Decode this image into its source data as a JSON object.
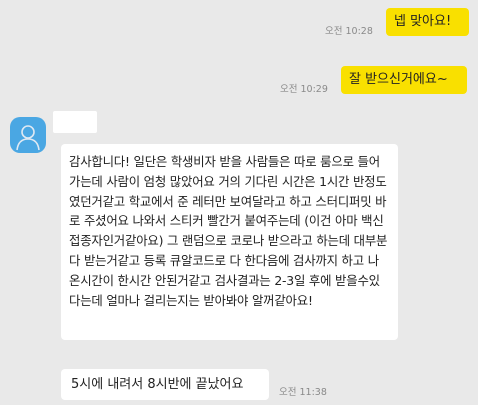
{
  "messages": [
    {
      "from": "me",
      "text": "넵 맞아요!",
      "time": "오전 10:28"
    },
    {
      "from": "me",
      "text": "잘 받으신거에요~",
      "time": "오전 10:29"
    },
    {
      "from": "other",
      "text": "감사합니다! 일단은 학생비자 받을 사람들은 따로 룸으로 들어가는데 사람이 엄청 많았어요 거의 기다린 시간은 1시간 반정도 였던거같고 학교에서 준 레터만 보여달라고 하고 스터디퍼밋 바로 주셨어요 나와서 스티커 빨간거 붙여주는데 (이건 아마 백신접종자인거같아요) 그 랜덤으로 코로나 받으라고 하는데 대부분 다 받는거같고 등록 큐알코드로 다 한다음에 검사까지 하고 나온시간이 한시간 안된거같고 검사결과는 2-3일 후에 받을수있다는데 얼마나 걸리는지는 받아봐야 알꺼같아요!"
    },
    {
      "from": "other",
      "text": "5시에 내려서 8시반에 끝났어요",
      "time": "오전 11:38"
    }
  ],
  "colors": {
    "background": "#e9e9e9",
    "my_bubble": "#f9e000",
    "their_bubble": "#ffffff",
    "avatar": "#4aa7e3"
  },
  "icons": {
    "avatar": "default-profile-person-icon"
  }
}
